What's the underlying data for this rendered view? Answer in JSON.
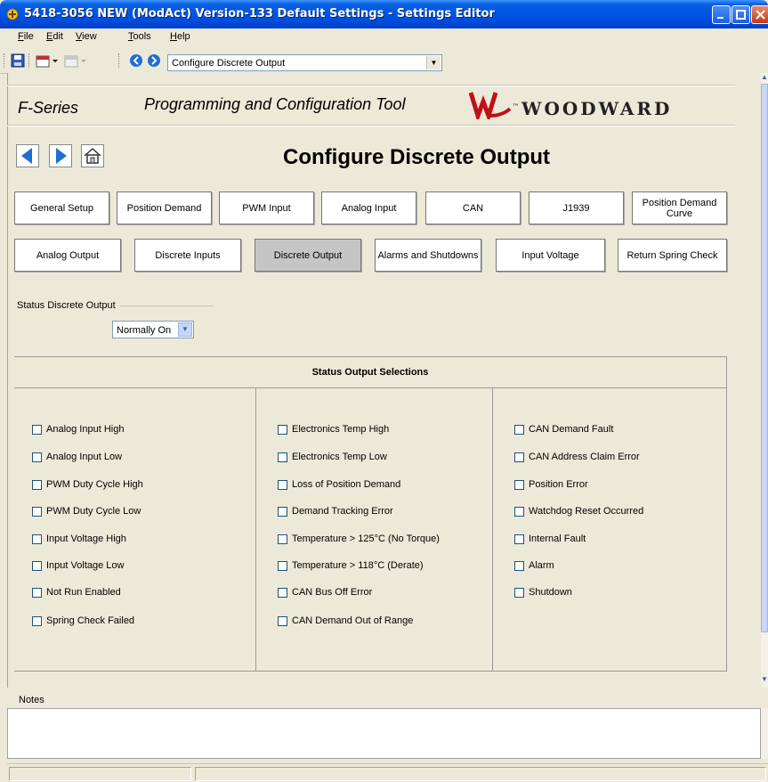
{
  "window": {
    "title": "5418-3056 NEW (ModAct) Version-133 Default Settings - Settings Editor"
  },
  "menu": {
    "items": [
      {
        "label": "File"
      },
      {
        "label": "Edit"
      },
      {
        "label": "View"
      },
      {
        "label": "Tools"
      },
      {
        "label": "Help"
      }
    ]
  },
  "toolbar": {
    "page_select_value": "Configure Discrete Output"
  },
  "header": {
    "series": "F-Series",
    "tool_name": "Programming and Configuration Tool",
    "brand": "WOODWARD",
    "brand_tm": "™"
  },
  "page": {
    "title": "Configure  Discrete Output"
  },
  "tabs_row1": [
    {
      "label": "General Setup"
    },
    {
      "label": "Position Demand"
    },
    {
      "label": "PWM Input"
    },
    {
      "label": "Analog Input"
    },
    {
      "label": "CAN"
    },
    {
      "label": "J1939"
    },
    {
      "label": "Position Demand Curve"
    }
  ],
  "tabs_row2": [
    {
      "label": "Analog Output"
    },
    {
      "label": "Discrete Inputs"
    },
    {
      "label": "Discrete Output",
      "active": true
    },
    {
      "label": "Alarms and Shutdowns"
    },
    {
      "label": "Input Voltage"
    },
    {
      "label": "Return Spring Check"
    }
  ],
  "status_output": {
    "group_label": "Status Discrete Output",
    "selected": "Normally On"
  },
  "selections": {
    "header": "Status Output Selections",
    "col1": [
      {
        "label": "Analog Input High",
        "checked": false
      },
      {
        "label": "Analog Input Low",
        "checked": false
      },
      {
        "label": "PWM Duty Cycle High",
        "checked": false
      },
      {
        "label": "PWM Duty Cycle Low",
        "checked": false
      },
      {
        "label": "Input Voltage High",
        "checked": false
      },
      {
        "label": "Input Voltage Low",
        "checked": false
      },
      {
        "label": "Not Run Enabled",
        "checked": false
      },
      {
        "label": "Spring Check Failed",
        "checked": false
      }
    ],
    "col2": [
      {
        "label": "Electronics Temp High",
        "checked": false
      },
      {
        "label": "Electronics Temp Low",
        "checked": false
      },
      {
        "label": "Loss of Position Demand",
        "checked": false
      },
      {
        "label": "Demand Tracking Error",
        "checked": false
      },
      {
        "label": "Temperature > 125°C (No Torque)",
        "checked": false
      },
      {
        "label": "Temperature > 118°C (Derate)",
        "checked": false
      },
      {
        "label": "CAN Bus Off Error",
        "checked": false
      },
      {
        "label": "CAN Demand Out of Range",
        "checked": false
      }
    ],
    "col3": [
      {
        "label": "CAN Demand Fault",
        "checked": false
      },
      {
        "label": "CAN Address Claim Error",
        "checked": false
      },
      {
        "label": "Position Error",
        "checked": false
      },
      {
        "label": "Watchdog Reset Occurred",
        "checked": false
      },
      {
        "label": "Internal Fault",
        "checked": false
      },
      {
        "label": "Alarm",
        "checked": false
      },
      {
        "label": "Shutdown",
        "checked": false
      }
    ]
  },
  "notes": {
    "label": "Notes",
    "value": ""
  },
  "icons": {
    "back": "arrow-left-icon",
    "forward": "arrow-right-icon",
    "home": "home-icon",
    "save": "save-icon"
  },
  "colors": {
    "nav_arrow": "#1f6fd1",
    "active_tab": "#c5c5c5",
    "title_bar": "#0055e5"
  }
}
